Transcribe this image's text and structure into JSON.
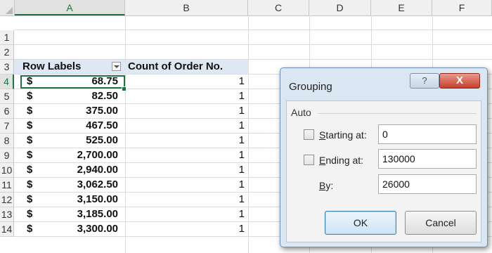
{
  "spreadsheet": {
    "columns": [
      "A",
      "B",
      "C",
      "D",
      "E",
      "F"
    ],
    "selected_column": "A",
    "selected_row": "4",
    "rows": [
      {
        "num": "1",
        "type": "empty"
      },
      {
        "num": "2",
        "type": "empty"
      },
      {
        "num": "3",
        "type": "header",
        "a": "Row Labels",
        "b": "Count of Order No."
      },
      {
        "num": "4",
        "type": "data",
        "cur": "$",
        "amt": "68.75",
        "count": "1"
      },
      {
        "num": "5",
        "type": "data",
        "cur": "$",
        "amt": "82.50",
        "count": "1"
      },
      {
        "num": "6",
        "type": "data",
        "cur": "$",
        "amt": "375.00",
        "count": "1"
      },
      {
        "num": "7",
        "type": "data",
        "cur": "$",
        "amt": "467.50",
        "count": "1"
      },
      {
        "num": "8",
        "type": "data",
        "cur": "$",
        "amt": "525.00",
        "count": "1"
      },
      {
        "num": "9",
        "type": "data",
        "cur": "$",
        "amt": "2,700.00",
        "count": "1"
      },
      {
        "num": "10",
        "type": "data",
        "cur": "$",
        "amt": "2,940.00",
        "count": "1"
      },
      {
        "num": "11",
        "type": "data",
        "cur": "$",
        "amt": "3,062.50",
        "count": "1"
      },
      {
        "num": "12",
        "type": "data",
        "cur": "$",
        "amt": "3,150.00",
        "count": "1"
      },
      {
        "num": "13",
        "type": "data",
        "cur": "$",
        "amt": "3,185.00",
        "count": "1"
      },
      {
        "num": "14",
        "type": "data",
        "cur": "$",
        "amt": "3,300.00",
        "count": "1"
      }
    ],
    "filter_icon": "dropdown-arrow-icon",
    "accent_color": "#217346"
  },
  "dialog": {
    "title": "Grouping",
    "help_icon": "?",
    "close_icon": "X",
    "section_label": "Auto",
    "starting_at": {
      "label_u": "S",
      "label_rest": "tarting at:",
      "value": "0",
      "checked": false
    },
    "ending_at": {
      "label_u": "E",
      "label_rest": "nding at:",
      "value": "130000",
      "checked": false
    },
    "by": {
      "label_u": "B",
      "label_rest": "y:",
      "value": "26000"
    },
    "ok_label": "OK",
    "cancel_label": "Cancel"
  }
}
